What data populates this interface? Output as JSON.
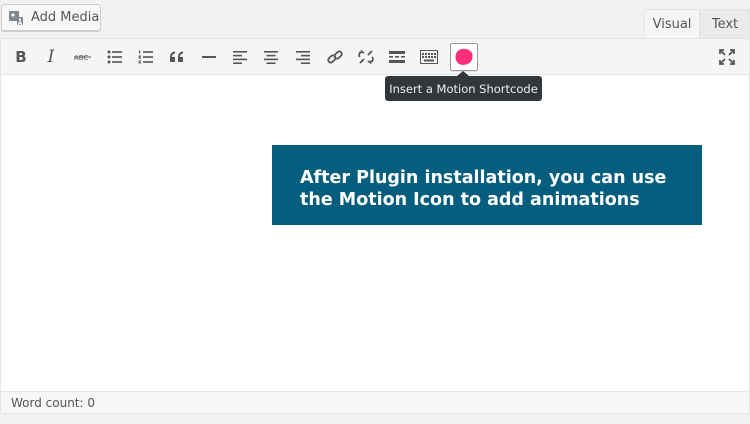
{
  "header": {
    "add_media_label": "Add Media",
    "tabs": [
      {
        "label": "Visual",
        "active": true
      },
      {
        "label": "Text",
        "active": false
      }
    ]
  },
  "toolbar": {
    "bold_label": "B",
    "italic_label": "I",
    "buttons": [
      "bold-icon",
      "italic-icon",
      "strikethrough-icon",
      "bulleted-list-icon",
      "numbered-list-icon",
      "blockquote-icon",
      "horizontal-line-icon",
      "align-left-icon",
      "align-center-icon",
      "align-right-icon",
      "insert-link-icon",
      "remove-link-icon",
      "read-more-icon",
      "toolbar-toggle-icon",
      "motion-shortcode-icon",
      "fullscreen-icon"
    ],
    "motion_icon_color": "#ff2e79"
  },
  "tooltip": {
    "text": "Insert a Motion Shortcode"
  },
  "callout": {
    "line1": "After Plugin installation, you can use",
    "line2": "the Motion Icon to add animations",
    "background": "#065e7e"
  },
  "status": {
    "word_count": "Word count: 0"
  }
}
